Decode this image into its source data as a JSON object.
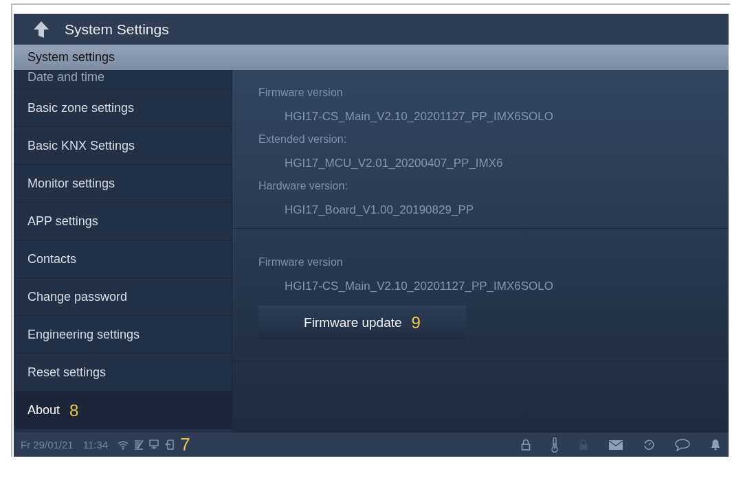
{
  "header": {
    "title": "System Settings"
  },
  "subheader": {
    "title": "System settings"
  },
  "menu": [
    {
      "label": "Date and time",
      "selected": false
    },
    {
      "label": "Basic zone settings",
      "selected": false
    },
    {
      "label": "Basic KNX Settings",
      "selected": false
    },
    {
      "label": "Monitor settings",
      "selected": false
    },
    {
      "label": "APP settings",
      "selected": false
    },
    {
      "label": "Contacts",
      "selected": false
    },
    {
      "label": "Change password",
      "selected": false
    },
    {
      "label": "Engineering settings",
      "selected": false
    },
    {
      "label": "Reset settings",
      "selected": false
    },
    {
      "label": "About",
      "selected": true,
      "callout": "8"
    }
  ],
  "sections": [
    {
      "fields": [
        {
          "label": "Firmware version",
          "value": "HGI17-CS_Main_V2.10_20201127_PP_IMX6SOLO"
        },
        {
          "label": "Extended version:",
          "value": "HGI17_MCU_V2.01_20200407_PP_IMX6"
        },
        {
          "label": "Hardware version:",
          "value": "HGI17_Board_V1.00_20190829_PP"
        }
      ]
    },
    {
      "fields": [
        {
          "label": "Firmware version",
          "value": "HGI17-CS_Main_V2.10_20201127_PP_IMX6SOLO"
        }
      ],
      "button": {
        "label": "Firmware update",
        "callout": "9"
      }
    }
  ],
  "status_bar": {
    "date": "Fr 29/01/21",
    "time": "11:34",
    "callout": "7"
  }
}
